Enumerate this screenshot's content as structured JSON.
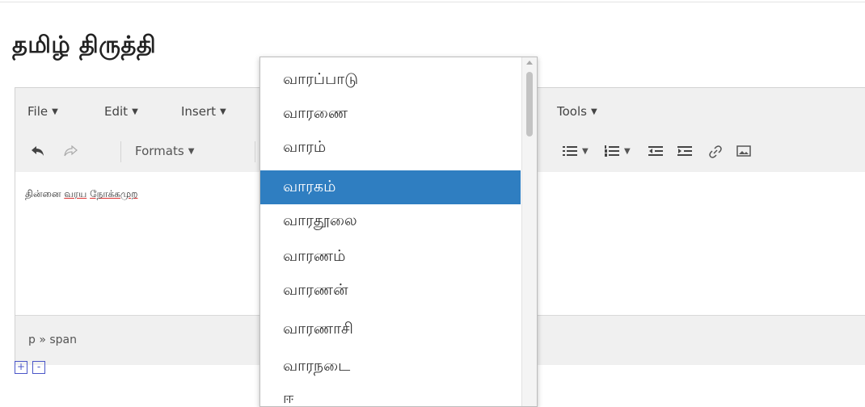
{
  "page": {
    "title": "தமிழ் திருத்தி"
  },
  "menubar": {
    "items": [
      {
        "label": "File"
      },
      {
        "label": "Edit"
      },
      {
        "label": "Insert"
      },
      {
        "label": "Tools"
      }
    ]
  },
  "toolbar": {
    "formats_label": "Formats"
  },
  "content": {
    "text_plain": "தின்னை ",
    "text_spell1": "வரய",
    "text_space": " ",
    "text_spell2": "நோக்கமுற"
  },
  "statusbar": {
    "path": "p » span"
  },
  "zoom": {
    "plus": "+",
    "minus": "-"
  },
  "suggestions": {
    "items": [
      "வாரப்பாடு",
      "வாரணை",
      "வாரம்",
      "வாரகம்",
      "வாரதூலை",
      "வாரணம்",
      "வாரணன்",
      "வாரணாசி",
      "வாரநடை",
      "ஈ"
    ],
    "selected_index": 3
  },
  "icons": [
    "undo-icon",
    "redo-icon",
    "bullet-list-icon",
    "numbered-list-icon",
    "outdent-icon",
    "indent-icon",
    "link-icon",
    "image-icon",
    "chevron-down-icon",
    "scroll-up-icon"
  ]
}
